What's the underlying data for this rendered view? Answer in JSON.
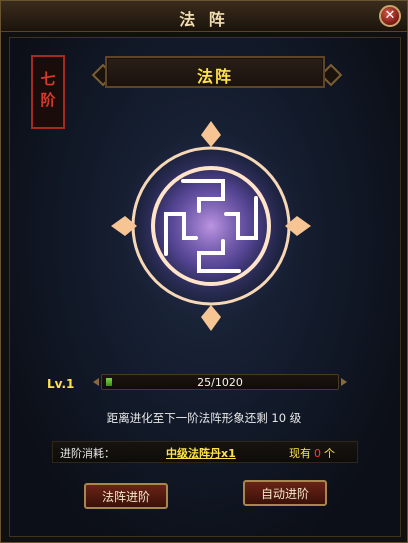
{
  "window": {
    "title": "法 阵",
    "close_label": "✕"
  },
  "stage": {
    "badge": "七阶"
  },
  "formation": {
    "title": "法阵"
  },
  "level": {
    "label": "Lv.1",
    "progress_text": "25/1020",
    "progress_fraction": 0.0245
  },
  "hint": "距离进化至下一阶法阵形象还剩 10 级",
  "cost": {
    "label": "进阶消耗：",
    "item": "中级法阵丹x1",
    "own_prefix": "现有",
    "own_count": "0",
    "own_suffix": "个"
  },
  "buttons": {
    "advance": "法阵进阶",
    "auto_advance": "自动进阶"
  },
  "colors": {
    "accent_gold": "#ffe14a",
    "seal_red": "#d33a2b",
    "progress_green": "#7ed34a",
    "count_red": "#ff3b2f"
  }
}
